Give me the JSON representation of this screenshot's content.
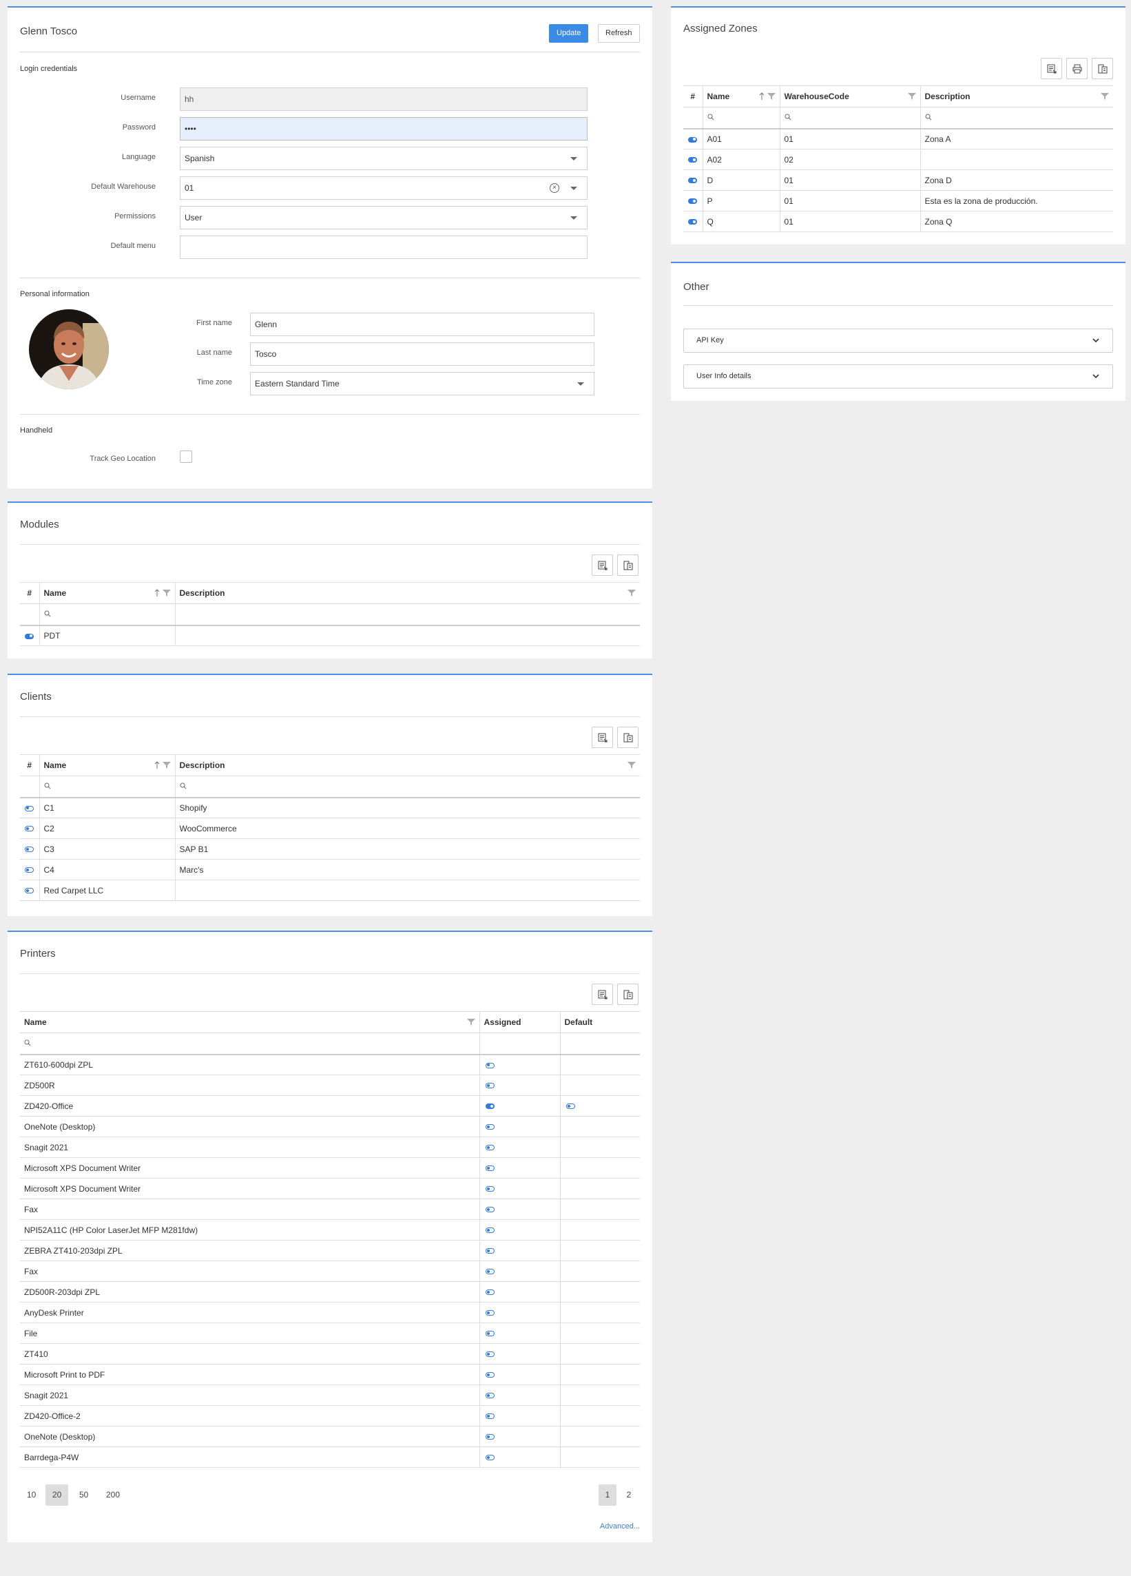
{
  "user_panel": {
    "title": "Glenn Tosco",
    "update_label": "Update",
    "refresh_label": "Refresh",
    "login_section": "Login credentials",
    "fields": {
      "username_label": "Username",
      "username_value": "hh",
      "password_label": "Password",
      "password_value": "••••",
      "language_label": "Language",
      "language_value": "Spanish",
      "warehouse_label": "Default Warehouse",
      "warehouse_value": "01",
      "permissions_label": "Permissions",
      "permissions_value": "User",
      "menu_label": "Default menu",
      "menu_value": ""
    },
    "personal_section": "Personal information",
    "personal": {
      "first_name_label": "First name",
      "first_name_value": "Glenn",
      "last_name_label": "Last name",
      "last_name_value": "Tosco",
      "timezone_label": "Time zone",
      "timezone_value": "Eastern Standard Time"
    },
    "handheld_section": "Handheld",
    "track_geo_label": "Track Geo Location",
    "track_geo_checked": false
  },
  "zones_panel": {
    "title": "Assigned Zones",
    "columns": [
      "#",
      "Name",
      "WarehouseCode",
      "Description"
    ],
    "rows": [
      {
        "name": "A01",
        "code": "01",
        "description": "Zona A"
      },
      {
        "name": "A02",
        "code": "02",
        "description": ""
      },
      {
        "name": "D",
        "code": "01",
        "description": "Zona D"
      },
      {
        "name": "P",
        "code": "01",
        "description": "Esta es la zona de producción."
      },
      {
        "name": "Q",
        "code": "01",
        "description": "Zona Q"
      }
    ]
  },
  "other_panel": {
    "title": "Other",
    "api_key_label": "API Key",
    "user_info_label": "User Info details"
  },
  "modules_panel": {
    "title": "Modules",
    "columns": [
      "#",
      "Name",
      "Description"
    ],
    "rows": [
      {
        "name": "PDT",
        "description": "",
        "enabled": true
      }
    ]
  },
  "clients_panel": {
    "title": "Clients",
    "columns": [
      "#",
      "Name",
      "Description"
    ],
    "rows": [
      {
        "name": "C1",
        "description": "Shopify"
      },
      {
        "name": "C2",
        "description": "WooCommerce"
      },
      {
        "name": "C3",
        "description": "SAP B1"
      },
      {
        "name": "C4",
        "description": "Marc's"
      },
      {
        "name": "Red Carpet LLC",
        "description": ""
      }
    ]
  },
  "printers_panel": {
    "title": "Printers",
    "columns": [
      "Name",
      "Assigned",
      "Default"
    ],
    "rows": [
      {
        "name": "ZT610-600dpi ZPL",
        "assigned": false,
        "default": null
      },
      {
        "name": "ZD500R",
        "assigned": false,
        "default": null
      },
      {
        "name": "ZD420-Office",
        "assigned": true,
        "default": false
      },
      {
        "name": "OneNote (Desktop)",
        "assigned": false,
        "default": null
      },
      {
        "name": "Snagit 2021",
        "assigned": false,
        "default": null
      },
      {
        "name": "Microsoft XPS Document Writer",
        "assigned": false,
        "default": null
      },
      {
        "name": "Microsoft XPS Document Writer",
        "assigned": false,
        "default": null
      },
      {
        "name": "Fax",
        "assigned": false,
        "default": null
      },
      {
        "name": "NPI52A11C (HP Color LaserJet MFP M281fdw)",
        "assigned": false,
        "default": null
      },
      {
        "name": "ZEBRA ZT410-203dpi ZPL",
        "assigned": false,
        "default": null
      },
      {
        "name": "Fax",
        "assigned": false,
        "default": null
      },
      {
        "name": "ZD500R-203dpi ZPL",
        "assigned": false,
        "default": null
      },
      {
        "name": "AnyDesk Printer",
        "assigned": false,
        "default": null
      },
      {
        "name": "File",
        "assigned": false,
        "default": null
      },
      {
        "name": "ZT410",
        "assigned": false,
        "default": null
      },
      {
        "name": "Microsoft Print to PDF",
        "assigned": false,
        "default": null
      },
      {
        "name": "Snagit 2021",
        "assigned": false,
        "default": null
      },
      {
        "name": "ZD420-Office-2",
        "assigned": false,
        "default": null
      },
      {
        "name": "OneNote (Desktop)",
        "assigned": false,
        "default": null
      },
      {
        "name": "Barrdega-P4W",
        "assigned": false,
        "default": null
      }
    ],
    "page_sizes": [
      "10",
      "20",
      "50",
      "200"
    ],
    "active_page_size": "20",
    "pages": [
      "1",
      "2"
    ],
    "active_page": "1",
    "advanced_label": "Advanced..."
  },
  "colors": {
    "accent": "#3b8ae6",
    "panel_border": "#4a8ee8",
    "background": "#eeeeee"
  },
  "icons": [
    "export-excel-icon",
    "print-icon",
    "column-chooser-icon",
    "filter-icon",
    "sort-icon",
    "search-icon",
    "toggle-icon",
    "chevron-down-icon",
    "clear-icon"
  ]
}
